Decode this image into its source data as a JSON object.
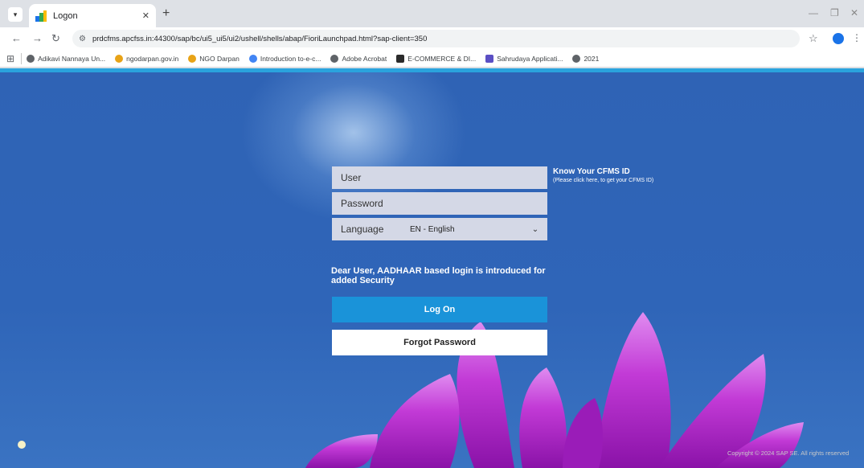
{
  "browser": {
    "tab": {
      "title": "Logon"
    },
    "url": "prdcfms.apcfss.in:44300/sap/bc/ui5_ui5/ui2/ushell/shells/abap/FioriLaunchpad.html?sap-client=350",
    "bookmarks": [
      {
        "label": "Adikavi Nannaya Un...",
        "color": "#5f6368"
      },
      {
        "label": "ngodarpan.gov.in",
        "color": "#e8a317"
      },
      {
        "label": "NGO Darpan",
        "color": "#e8a317"
      },
      {
        "label": "Introduction to-e-c...",
        "color": "#4285f4"
      },
      {
        "label": "Adobe Acrobat",
        "color": "#5f6368"
      },
      {
        "label": "E-COMMERCE & DI...",
        "color": "#2b2b2b"
      },
      {
        "label": "Sahrudaya Applicati...",
        "color": "#5b4fc4"
      },
      {
        "label": "2021",
        "color": "#5f6368"
      }
    ]
  },
  "login": {
    "user_placeholder": "User",
    "password_placeholder": "Password",
    "language_label": "Language",
    "language_value": "EN - English",
    "know_title": "Know Your CFMS ID",
    "know_subtitle": "(Please click here, to get your CFMS ID)",
    "notice": "Dear User, AADHAAR based login is introduced for added Security",
    "logon_label": "Log On",
    "forgot_label": "Forgot Password"
  },
  "footer": {
    "copyright": "Copyright © 2024 SAP SE. All rights reserved"
  },
  "colors": {
    "background": "#2f63b5",
    "accent": "#2aa3dd",
    "logon_button": "#1a93d9",
    "flower": "#c23ad6"
  }
}
